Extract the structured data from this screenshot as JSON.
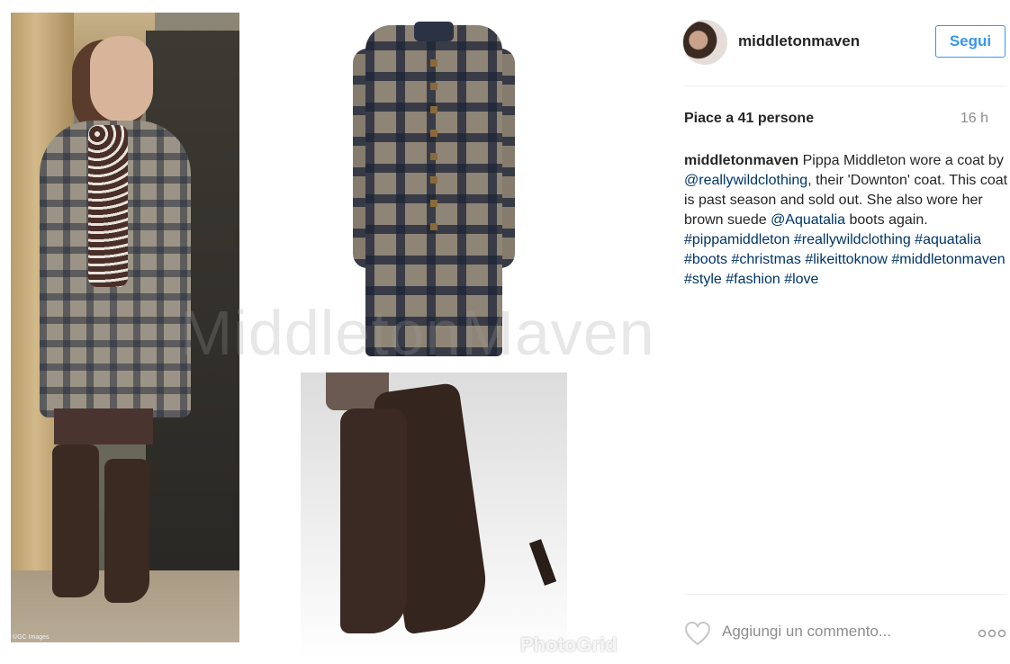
{
  "media": {
    "watermark": "MiddletonMaven",
    "photogrid_label": "PhotoGrid",
    "photo_credit": "©GC Images"
  },
  "header": {
    "username": "middletonmaven",
    "follow_label": "Segui"
  },
  "post": {
    "likes_prefix": "Piace a ",
    "likes_count": "41",
    "likes_suffix": " persone",
    "time": "16 h",
    "caption_user": "middletonmaven",
    "caption_part1": " Pippa Middleton wore a coat by ",
    "mention1": "@reallywildclothing",
    "caption_part2": ", their 'Downton' coat. This coat is past season and sold out. She also wore her brown suede ",
    "mention2": "@Aquatalia",
    "caption_part3": " boots again. ",
    "hashtags": [
      "#pippamiddleton",
      "#reallywildclothing",
      "#aquatalia",
      "#boots",
      "#christmas",
      "#likeittoknow",
      "#middletonmaven",
      "#style",
      "#fashion",
      "#love"
    ]
  },
  "footer": {
    "comment_placeholder": "Aggiungi un commento...",
    "icons": [
      "heart-icon",
      "more-options-icon"
    ]
  }
}
